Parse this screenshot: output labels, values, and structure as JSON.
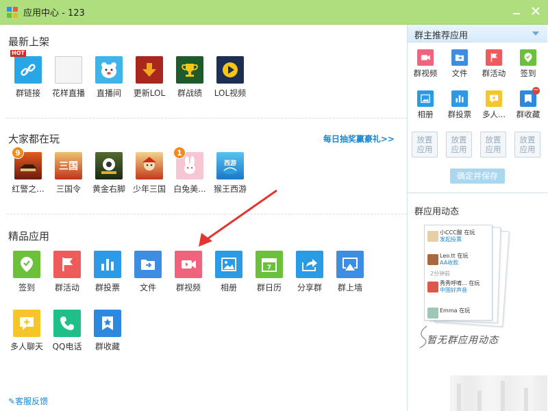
{
  "window": {
    "title": "应用中心 - 123"
  },
  "colors": {
    "titlebar": "#aede7e",
    "link": "#1b87d4",
    "badge": "#f28a1d"
  },
  "sections": {
    "latest": {
      "title": "最新上架",
      "apps": [
        {
          "label": "群链接",
          "icon": "link-icon",
          "badge": "HOT"
        },
        {
          "label": "花样直播",
          "icon": "blank-icon"
        },
        {
          "label": "直播间",
          "icon": "bear-icon"
        },
        {
          "label": "更新LOL",
          "icon": "download-arrow-icon"
        },
        {
          "label": "群战绩",
          "icon": "trophy-icon"
        },
        {
          "label": "LOL视频",
          "icon": "play-icon"
        }
      ]
    },
    "popular": {
      "title": "大家都在玩",
      "promo": "每日抽奖赢豪礼>>",
      "apps": [
        {
          "label": "红警之...",
          "icon": "red-alert-game-icon",
          "badge": "9"
        },
        {
          "label": "三国令",
          "icon": "three-kingdoms-icon"
        },
        {
          "label": "黄金右脚",
          "icon": "golden-foot-icon"
        },
        {
          "label": "少年三国",
          "icon": "young-three-kingdoms-icon"
        },
        {
          "label": "白兔美...",
          "icon": "white-rabbit-icon",
          "badge": "1"
        },
        {
          "label": "猴王西游",
          "icon": "monkey-king-icon"
        }
      ]
    },
    "featured": {
      "title": "精品应用",
      "apps": [
        {
          "label": "签到",
          "icon": "check-in-icon"
        },
        {
          "label": "群活动",
          "icon": "flag-icon"
        },
        {
          "label": "群投票",
          "icon": "bar-chart-icon"
        },
        {
          "label": "文件",
          "icon": "folder-icon"
        },
        {
          "label": "群视频",
          "icon": "video-camera-icon"
        },
        {
          "label": "相册",
          "icon": "picture-icon"
        },
        {
          "label": "群日历",
          "icon": "calendar-icon"
        },
        {
          "label": "分享群",
          "icon": "share-icon"
        },
        {
          "label": "群上墙",
          "icon": "screen-cast-icon"
        },
        {
          "label": "多人聊天",
          "icon": "chat-plus-icon"
        },
        {
          "label": "QQ电话",
          "icon": "phone-icon"
        },
        {
          "label": "群收藏",
          "icon": "bookmark-star-icon"
        }
      ]
    }
  },
  "footer": {
    "feedback": "客服反馈"
  },
  "recommend": {
    "title": "群主推荐应用",
    "apps": [
      {
        "label": "群视频",
        "icon": "video-camera-icon"
      },
      {
        "label": "文件",
        "icon": "folder-icon"
      },
      {
        "label": "群活动",
        "icon": "flag-icon"
      },
      {
        "label": "签到",
        "icon": "check-in-icon"
      },
      {
        "label": "相册",
        "icon": "picture-icon"
      },
      {
        "label": "群投票",
        "icon": "bar-chart-icon"
      },
      {
        "label": "多人...",
        "icon": "chat-plus-icon"
      },
      {
        "label": "群收藏",
        "icon": "bookmark-star-icon"
      }
    ],
    "slot_label": "放置应用",
    "save_label": "确定并保存"
  },
  "dynamics": {
    "title": "群应用动态",
    "empty_text": "暂无群应用动态",
    "feed": [
      {
        "name": "小CCC酸",
        "verb": "在玩",
        "action": "发起投票"
      },
      {
        "name": "Leo.tt",
        "verb": "在玩",
        "action": "AA收款"
      },
      {
        "name": "2分钟前",
        "verb": "",
        "action": ""
      },
      {
        "name": "秀秀呼唷...",
        "verb": "在玩",
        "action": "中国好声音"
      },
      {
        "name": "Emma",
        "verb": "在玩",
        "action": ""
      }
    ]
  }
}
